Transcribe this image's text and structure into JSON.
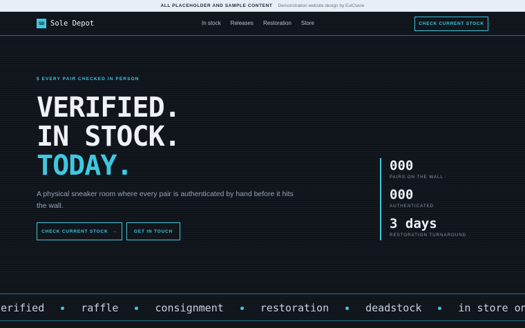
{
  "banner": {
    "label": "ALL PLACEHOLDER AND SAMPLE CONTENT",
    "credit": "Demonstration website design by EulClavie"
  },
  "nav": {
    "logo_badge": "SD",
    "brand": "Sole Depot",
    "links": [
      "In stock",
      "Releases",
      "Restoration",
      "Store"
    ],
    "cta": "CHECK CURRENT STOCK"
  },
  "hero": {
    "eyebrow": "$ EVERY PAIR CHECKED IN PERSON",
    "headline": [
      "VERIFIED.",
      "IN STOCK.",
      "TODAY."
    ],
    "subtext": "A physical sneaker room where every pair is authenticated by hand before it hits the wall.",
    "primary_button": "CHECK CURRENT STOCK",
    "primary_arrow": "→",
    "secondary_button": "GET IN TOUCH"
  },
  "stats": [
    {
      "value": "000",
      "label": "PAIRS ON THE WALL"
    },
    {
      "value": "000",
      "label": "AUTHENTICATED"
    },
    {
      "value": "3 days",
      "label": "RESTORATION TURNAROUND"
    }
  ],
  "ticker": [
    "verified",
    "raffle",
    "consignment",
    "restoration",
    "deadstock",
    "in store only"
  ],
  "colors": {
    "background": "#0f141b",
    "accent": "#3fc7e0",
    "banner_bg": "#e8eef5"
  }
}
